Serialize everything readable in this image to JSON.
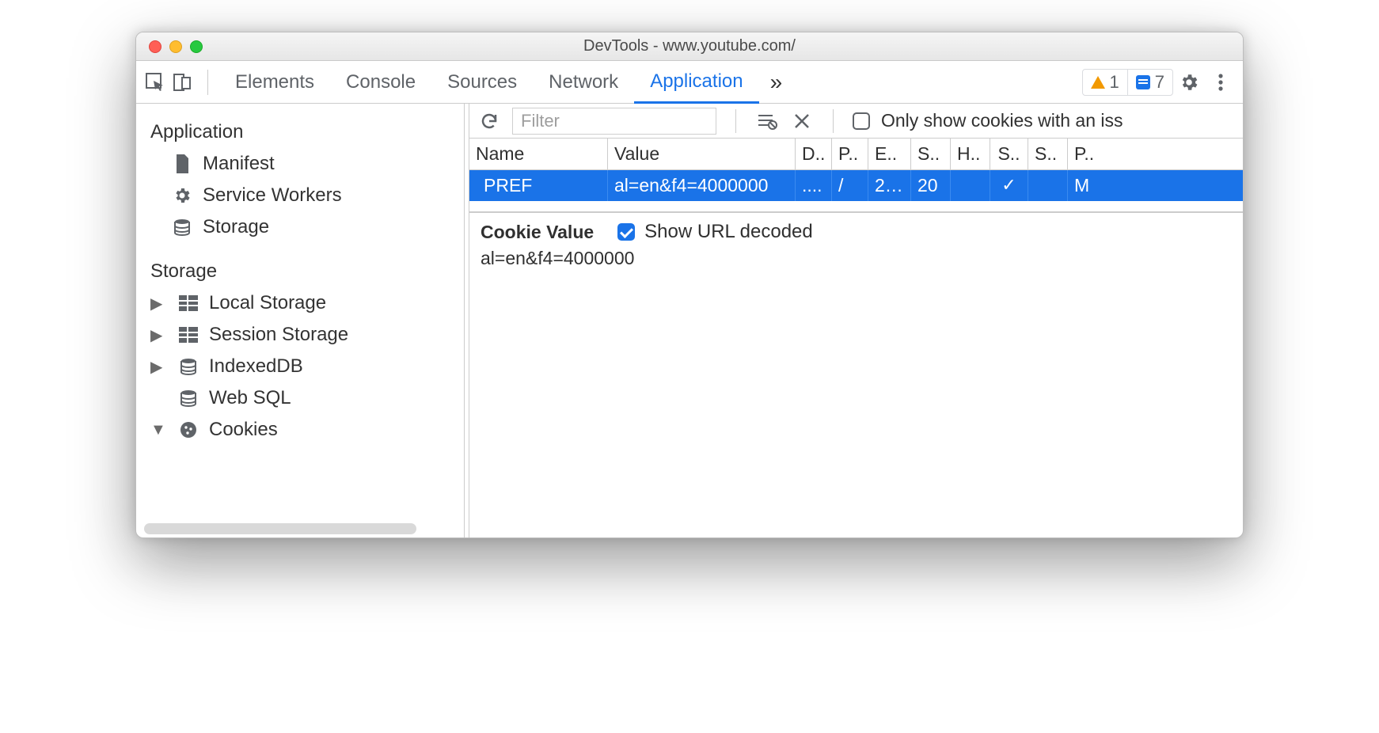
{
  "window_title": "DevTools - www.youtube.com/",
  "tabs": [
    "Elements",
    "Console",
    "Sources",
    "Network",
    "Application"
  ],
  "active_tab": "Application",
  "warning_count": "1",
  "message_count": "7",
  "sidebar": {
    "section_app": "Application",
    "items_app": [
      "Manifest",
      "Service Workers",
      "Storage"
    ],
    "section_storage": "Storage",
    "items_storage": [
      "Local Storage",
      "Session Storage",
      "IndexedDB",
      "Web SQL",
      "Cookies"
    ]
  },
  "main_toolbar": {
    "filter_placeholder": "Filter",
    "only_issue": "Only show cookies with an iss"
  },
  "table": {
    "headers": [
      "Name",
      "Value",
      "D..",
      "P..",
      "E..",
      "S..",
      "H..",
      "S..",
      "S..",
      "P.."
    ],
    "row": {
      "name": "PREF",
      "value": "al=en&f4=4000000",
      "d": "....",
      "p": "/",
      "e": "2…",
      "s1": "20",
      "h": "",
      "s2": "✓",
      "s3": "",
      "pri": "M"
    }
  },
  "detail": {
    "heading": "Cookie Value",
    "decode_label": "Show URL decoded",
    "value": "al=en&f4=4000000"
  }
}
